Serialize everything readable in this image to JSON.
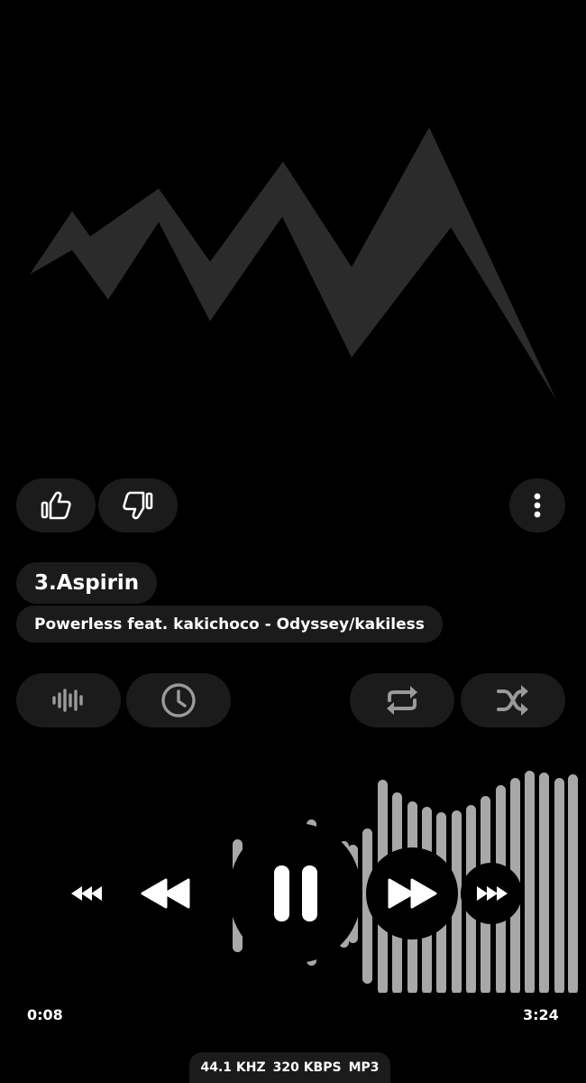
{
  "track": {
    "title": "3.Aspirin",
    "subtitle": "Powerless feat. kakichoco - Odyssey/kakiless"
  },
  "playback": {
    "elapsed": "0:08",
    "duration": "3:24",
    "state": "playing"
  },
  "quality": {
    "sample_rate": "44.1 KHZ",
    "bitrate": "320 KBPS",
    "format": "MP3"
  },
  "icons": {
    "like": "thumbs-up-icon",
    "dislike": "thumbs-down-icon",
    "menu": "more-vertical-icon",
    "equalizer": "waveform-icon",
    "sleep_timer": "clock-icon",
    "repeat": "repeat-icon",
    "shuffle": "shuffle-icon",
    "skip_back": "skip-back-icon",
    "rewind": "rewind-icon",
    "pause": "pause-icon",
    "fast_forward": "fast-forward-icon",
    "skip_forward": "skip-forward-icon"
  },
  "colors": {
    "background": "#000000",
    "chip": "#1b1b1b",
    "artwork": "#2b2b2b",
    "visualizer_bar": "#a8a8a8",
    "icon_muted": "#9a9a9a"
  }
}
